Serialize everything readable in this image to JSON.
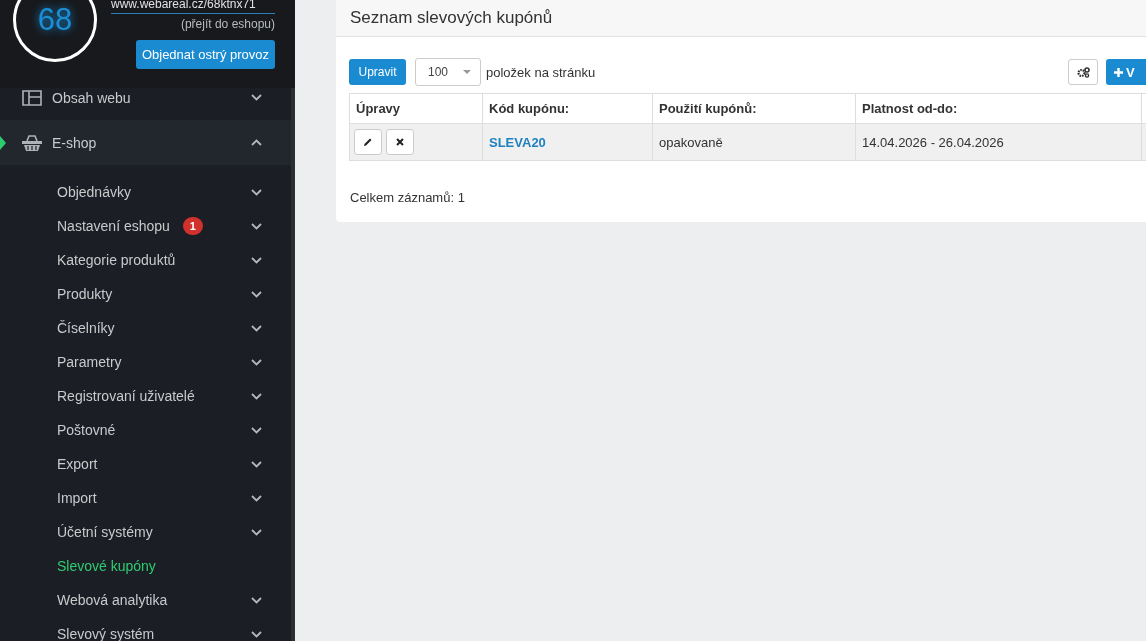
{
  "account": {
    "score": "68",
    "url": "www.webareal.cz/68ktnx71",
    "shop_link": "(přejít do eshopu)",
    "order_button": "Objednat ostrý provoz"
  },
  "sidebar": {
    "items": [
      {
        "label": "Obsah webu",
        "expanded": false,
        "selected": false
      },
      {
        "label": "E-shop",
        "expanded": true,
        "selected": true,
        "children": [
          {
            "label": "Objednávky",
            "expandable": true,
            "selected": false
          },
          {
            "label": "Nastavení eshopu",
            "expandable": true,
            "selected": false,
            "badge": "1"
          },
          {
            "label": "Kategorie produktů",
            "expandable": true,
            "selected": false
          },
          {
            "label": "Produkty",
            "expandable": true,
            "selected": false
          },
          {
            "label": "Číselníky",
            "expandable": true,
            "selected": false
          },
          {
            "label": "Parametry",
            "expandable": true,
            "selected": false
          },
          {
            "label": "Registrovaní uživatelé",
            "expandable": true,
            "selected": false
          },
          {
            "label": "Poštovné",
            "expandable": true,
            "selected": false
          },
          {
            "label": "Export",
            "expandable": true,
            "selected": false
          },
          {
            "label": "Import",
            "expandable": true,
            "selected": false
          },
          {
            "label": "Účetní systémy",
            "expandable": true,
            "selected": false
          },
          {
            "label": "Slevové kupóny",
            "expandable": false,
            "selected": true
          },
          {
            "label": "Webová analytika",
            "expandable": true,
            "selected": false
          },
          {
            "label": "Slevový systém",
            "expandable": true,
            "selected": false
          }
        ]
      }
    ]
  },
  "main": {
    "title": "Seznam slevových kupónů",
    "toolbar": {
      "edit_button": "Upravit",
      "page_size": "100",
      "page_size_label": "položek na stránku",
      "add_button": "V"
    },
    "table": {
      "columns": [
        "Úpravy",
        "Kód kupónu:",
        "Použití kupónů:",
        "Platnost od-do:"
      ],
      "rows": [
        {
          "code": "SLEVA20",
          "usage": "opakovaně",
          "validity": "14.04.2026 - 26.04.2026"
        }
      ]
    },
    "total": "Celkem záznamů: 1"
  }
}
